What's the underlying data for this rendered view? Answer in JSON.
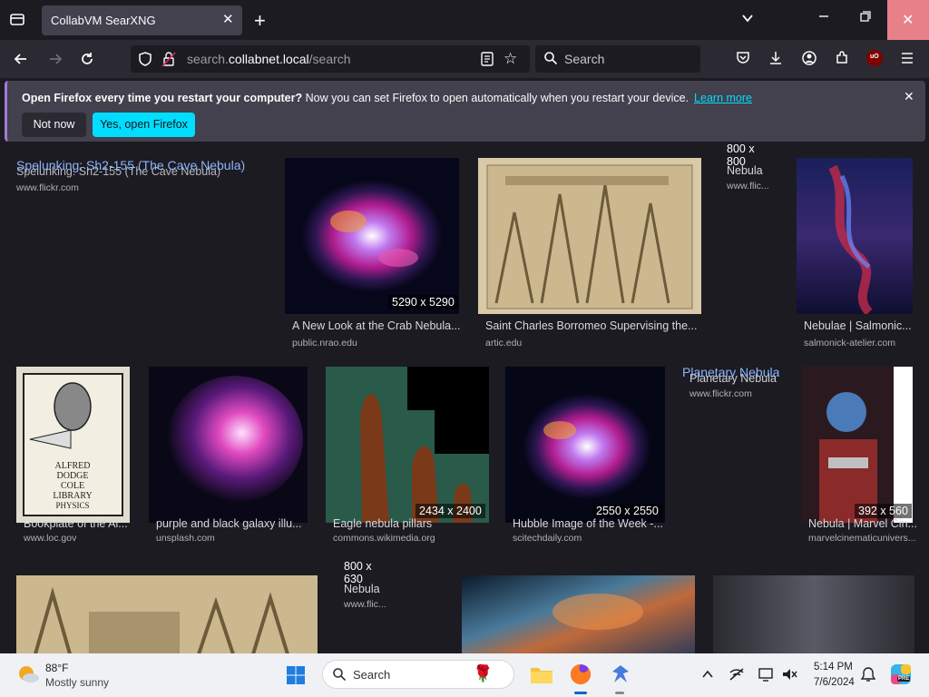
{
  "browser": {
    "tab_title": "CollabVM SearXNG",
    "url_prefix": "search.",
    "url_host": "collabnet.local",
    "url_path": "/search",
    "search_placeholder": "Search"
  },
  "notification": {
    "bold": "Open Firefox every time you restart your computer?",
    "text": "Now you can set Firefox to open automatically when you restart your device.",
    "link": "Learn more",
    "not_now": "Not now",
    "yes": "Yes, open Firefox"
  },
  "results": [
    {
      "title": "Spelunking: Sh2-155 (The Cave Nebula)",
      "link_title": "Spelunking: Sh2-155 (The Cave Nebula)",
      "url": "www.flickr.com"
    },
    {
      "title": "A New Look at the Crab Nebula...",
      "url": "public.nrao.edu",
      "size": "5290 x 5290"
    },
    {
      "title": "Saint Charles Borromeo Supervising the...",
      "url": "artic.edu"
    },
    {
      "title": "Nebula",
      "url": "www.flic...",
      "size_a": "800 x",
      "size_b": "800"
    },
    {
      "title": "Nebulae | Salmonic...",
      "url": "salmonick-atelier.com"
    },
    {
      "title": "Bookplate of the Al...",
      "url": "www.loc.gov"
    },
    {
      "title": "purple and black galaxy illu...",
      "url": "unsplash.com"
    },
    {
      "title": "Eagle nebula pillars",
      "url": "commons.wikimedia.org",
      "size": "2434 x 2400"
    },
    {
      "title": "Hubble Image of the Week -...",
      "url": "scitechdaily.com",
      "size": "2550 x 2550"
    },
    {
      "title": "Planetary Nebula",
      "link_title": "Planetary Nebula",
      "url": "www.flickr.com"
    },
    {
      "title": "Nebula | Marvel Cin...",
      "url": "marvelcinematicunivers...",
      "size": "392 x 560"
    },
    {
      "title": "Nebula",
      "url": "www.flic...",
      "size_a": "800 x",
      "size_b": "630"
    }
  ],
  "bookplate_text": {
    "line1": "ALFRED",
    "line2": "DODGE",
    "line3": "COLE",
    "line4": "LIBRARY",
    "line5": "PHYSICS"
  },
  "taskbar": {
    "temperature": "88°F",
    "weather": "Mostly sunny",
    "search_label": "Search",
    "time": "5:14 PM",
    "date": "7/6/2024",
    "pre_badge": "PRE"
  },
  "icons": [
    "tab-list-icon",
    "close-icon",
    "new-tab-icon",
    "chevron-down-icon",
    "minimize-icon",
    "maximize-icon",
    "back-icon",
    "forward-icon",
    "reload-icon",
    "shield-icon",
    "lock-icon",
    "reader-view-icon",
    "bookmark-star-icon",
    "search-icon",
    "pocket-icon",
    "download-icon",
    "account-icon",
    "extensions-icon",
    "ublock-icon",
    "menu-icon",
    "weather-icon",
    "windows-start-icon",
    "file-explorer-icon",
    "firefox-icon",
    "app-icon",
    "wifi-icon",
    "volume-icon",
    "bell-icon",
    "copilot-icon"
  ],
  "colors": {
    "accent": "#00ddff",
    "window_close": "#e8808a",
    "link": "#8ab4f8"
  }
}
